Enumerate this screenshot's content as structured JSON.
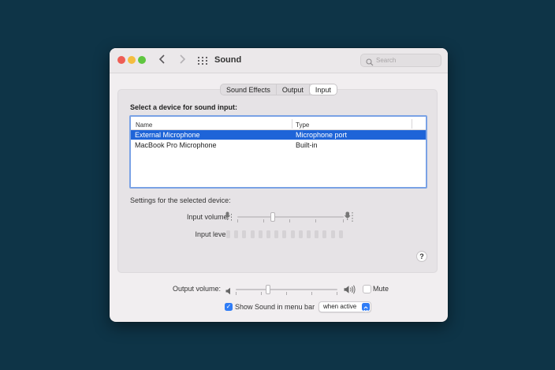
{
  "window": {
    "title": "Sound"
  },
  "search": {
    "placeholder": "Search"
  },
  "tabs": [
    {
      "label": "Sound Effects",
      "active": false
    },
    {
      "label": "Output",
      "active": false
    },
    {
      "label": "Input",
      "active": true
    }
  ],
  "input": {
    "section_label": "Select a device for sound input:",
    "columns": {
      "name": "Name",
      "type": "Type"
    },
    "devices": [
      {
        "name": "External Microphone",
        "type": "Microphone port",
        "selected": true
      },
      {
        "name": "MacBook Pro Microphone",
        "type": "Built-in",
        "selected": false
      }
    ],
    "settings_label": "Settings for the selected device:",
    "input_volume_label": "Input volume:",
    "input_volume_value": 0.33,
    "input_level_label": "Input level:",
    "input_level_segments": 15,
    "input_level_lit": 0,
    "help": "?"
  },
  "output": {
    "volume_label": "Output volume:",
    "volume_value": 0.32,
    "mute_label": "Mute",
    "mute_checked": false
  },
  "menubar": {
    "show_label": "Show Sound in menu bar",
    "show_checked": true,
    "mode": "when active"
  },
  "colors": {
    "desktop": "#0e3447",
    "selection": "#1e64d8",
    "accent": "#2f7cf6"
  },
  "icons": {
    "back": "chevron-left-icon",
    "forward": "chevron-right-icon",
    "grid": "grid-icon",
    "search": "search-icon",
    "mic_low": "microphone-low-icon",
    "mic_high": "microphone-high-icon",
    "speaker_low": "speaker-low-icon",
    "speaker_high": "speaker-high-icon"
  }
}
